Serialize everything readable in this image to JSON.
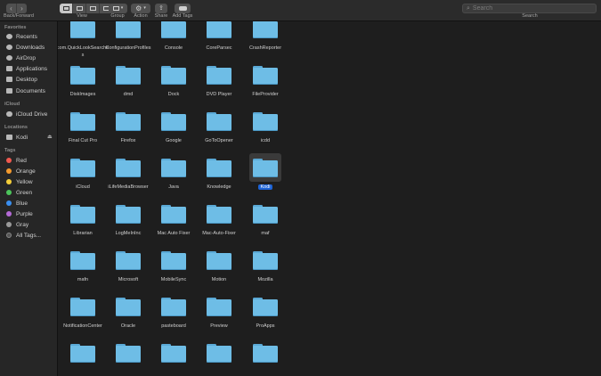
{
  "toolbar": {
    "back_forward_label": "Back/Forward",
    "view_label": "View",
    "group_label": "Group",
    "action_label": "Action",
    "share_label": "Share",
    "add_tags_label": "Add Tags",
    "search_label": "Search",
    "search_placeholder": "Search"
  },
  "sidebar": {
    "favorites_header": "Favorites",
    "favorites": [
      {
        "label": "Recents",
        "icon": "clock-icon"
      },
      {
        "label": "Downloads",
        "icon": "download-icon"
      },
      {
        "label": "AirDrop",
        "icon": "airdrop-icon"
      },
      {
        "label": "Applications",
        "icon": "applications-icon"
      },
      {
        "label": "Desktop",
        "icon": "desktop-icon"
      },
      {
        "label": "Documents",
        "icon": "document-icon"
      }
    ],
    "icloud_header": "iCloud",
    "icloud": [
      {
        "label": "iCloud Drive",
        "icon": "cloud-icon"
      }
    ],
    "locations_header": "Locations",
    "locations": [
      {
        "label": "Kodi",
        "icon": "disk-icon"
      }
    ],
    "tags_header": "Tags",
    "tags": [
      {
        "label": "Red",
        "color": "#f0594f"
      },
      {
        "label": "Orange",
        "color": "#f39a2e"
      },
      {
        "label": "Yellow",
        "color": "#f5ce3a"
      },
      {
        "label": "Green",
        "color": "#4cc55b"
      },
      {
        "label": "Blue",
        "color": "#3a8ff0"
      },
      {
        "label": "Purple",
        "color": "#b46ad6"
      },
      {
        "label": "Gray",
        "color": "#9a9a9a"
      },
      {
        "label": "All Tags...",
        "color": "#555555"
      }
    ]
  },
  "files": [
    [
      "com.QuickLookSearches",
      "ConfigurationProfiles",
      "Console",
      "CoreParsec",
      "CrashReporter"
    ],
    [
      "DiskImages",
      "dmd",
      "Dock",
      "DVD Player",
      "FileProvider"
    ],
    [
      "Final Cut Pro",
      "Firefox",
      "Google",
      "GoToOpener",
      "icdd"
    ],
    [
      "iCloud",
      "iLifeMediaBrowser",
      "Java",
      "Knowledge",
      "Kodi"
    ],
    [
      "Librarian",
      "LogMeInInc",
      "Mac Auto Fixer",
      "Mac-Auto-Fixer",
      "maf"
    ],
    [
      "mafn",
      "Microsoft",
      "MobileSync",
      "Motion",
      "Mozilla"
    ],
    [
      "NotificationCenter",
      "Oracle",
      "pasteboard",
      "Preview",
      "ProApps"
    ],
    [
      "",
      "",
      "",
      "",
      ""
    ]
  ],
  "selected_file": "Kodi"
}
